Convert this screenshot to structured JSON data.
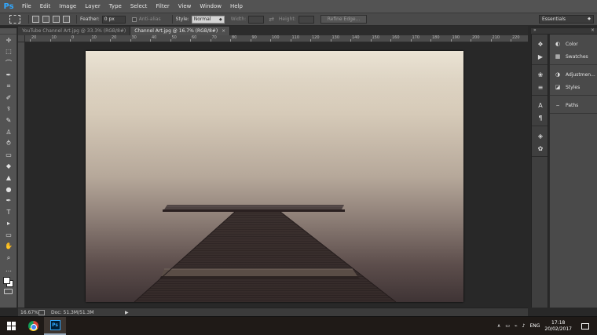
{
  "app": {
    "logo": "Ps"
  },
  "menu": [
    "File",
    "Edit",
    "Image",
    "Layer",
    "Type",
    "Select",
    "Filter",
    "View",
    "Window",
    "Help"
  ],
  "window_controls": {
    "minimize": "–",
    "restore": "❐",
    "close": "✕"
  },
  "options": {
    "feather_label": "Feather:",
    "feather_value": "0 px",
    "antialias_label": "Anti-alias",
    "style_label": "Style:",
    "style_value": "Normal",
    "width_label": "Width:",
    "height_label": "Height:",
    "swap_icon": "swap-arrows-icon",
    "refine_edge": "Refine Edge...",
    "workspace": "Essentials"
  },
  "tabs": [
    {
      "label": "YouTube Channel Art.jpg @ 33.3% (RGB/8#)",
      "active": false
    },
    {
      "label": "Channel Art.jpg @ 16.7% (RGB/8#)",
      "active": true,
      "close": "×"
    }
  ],
  "ruler": {
    "h_labels": [
      "20",
      "10",
      "0",
      "10",
      "20",
      "30",
      "40",
      "50",
      "60",
      "70",
      "80",
      "90",
      "100",
      "110",
      "120",
      "130",
      "140",
      "150",
      "160",
      "170",
      "180",
      "190",
      "200",
      "210",
      "220",
      "230"
    ]
  },
  "tools": [
    {
      "name": "move-tool-icon",
      "glyph": "✛"
    },
    {
      "name": "marquee-tool-icon",
      "glyph": "⬚"
    },
    {
      "name": "lasso-tool-icon",
      "glyph": "⌒"
    },
    {
      "name": "quick-selection-tool-icon",
      "glyph": "✒"
    },
    {
      "name": "crop-tool-icon",
      "glyph": "⌗"
    },
    {
      "name": "eyedropper-tool-icon",
      "glyph": "✐"
    },
    {
      "name": "healing-brush-tool-icon",
      "glyph": "⚕"
    },
    {
      "name": "brush-tool-icon",
      "glyph": "✎"
    },
    {
      "name": "clone-stamp-tool-icon",
      "glyph": "♙"
    },
    {
      "name": "history-brush-tool-icon",
      "glyph": "⥁"
    },
    {
      "name": "eraser-tool-icon",
      "glyph": "▭"
    },
    {
      "name": "paint-bucket-tool-icon",
      "glyph": "◆"
    },
    {
      "name": "blur-tool-icon",
      "glyph": "▲"
    },
    {
      "name": "dodge-tool-icon",
      "glyph": "●"
    },
    {
      "name": "pen-tool-icon",
      "glyph": "✒"
    },
    {
      "name": "type-tool-icon",
      "glyph": "T"
    },
    {
      "name": "path-selection-tool-icon",
      "glyph": "▸"
    },
    {
      "name": "rectangle-tool-icon",
      "glyph": "▭"
    },
    {
      "name": "hand-tool-icon",
      "glyph": "✋"
    },
    {
      "name": "zoom-tool-icon",
      "glyph": "⌕"
    },
    {
      "name": "edit-toolbar-icon",
      "glyph": "…"
    }
  ],
  "status": {
    "zoom": "16.67%",
    "doc": "Doc: 51.3M/51.3M",
    "arrow": "▶"
  },
  "right_strip": [
    [
      "history-icon",
      "play-actions-icon"
    ],
    [
      "brush-settings-icon",
      "brush-presets-icon"
    ],
    [
      "character-icon",
      "paragraph-icon"
    ],
    [
      "layers-icon",
      "channels-icon"
    ]
  ],
  "panels": [
    [
      {
        "icon": "color-panel-icon",
        "glyph": "◐",
        "label": "Color"
      },
      {
        "icon": "swatches-panel-icon",
        "glyph": "▦",
        "label": "Swatches"
      }
    ],
    [
      {
        "icon": "adjustments-panel-icon",
        "glyph": "◑",
        "label": "Adjustmen..."
      },
      {
        "icon": "styles-panel-icon",
        "glyph": "◪",
        "label": "Styles"
      }
    ],
    [
      {
        "icon": "paths-panel-icon",
        "glyph": "⌢",
        "label": "Paths"
      }
    ]
  ],
  "panel_header": {
    "collapse": "»",
    "close": "×"
  },
  "taskbar": {
    "tray_chevron": "∧",
    "tray_icons": [
      "▭",
      "⌁",
      "♪"
    ],
    "language": "ENG",
    "time": "17:18",
    "date": "20/02/2017"
  }
}
